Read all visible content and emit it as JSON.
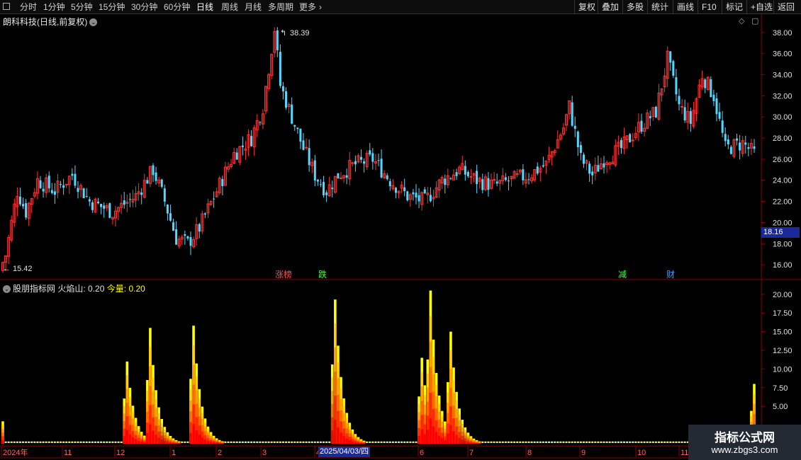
{
  "toolbar": {
    "periods": [
      "分时",
      "1分钟",
      "5分钟",
      "15分钟",
      "30分钟",
      "60分钟",
      "日线",
      "周线",
      "月线",
      "多周期",
      "更多"
    ],
    "active_period": "日线",
    "right_buttons": [
      "复权",
      "叠加",
      "多股",
      "统计",
      "画线",
      "F10",
      "标记",
      "+自选",
      "返回"
    ]
  },
  "main_chart": {
    "title": "朗科科技(日线,前复权)",
    "high_label": "38.39",
    "low_label": "15.42",
    "current_price": "18.16",
    "y_axis_labels": [
      "38.00",
      "36.00",
      "34.00",
      "32.00",
      "30.00",
      "28.00",
      "26.00",
      "24.00",
      "22.00",
      "20.00",
      "18.00",
      "16.00"
    ],
    "y_range": [
      14.8,
      39.6
    ],
    "event_markers": [
      {
        "text": "涨榜",
        "color": "#ff5050"
      },
      {
        "text": "跌",
        "color": "#40ff40"
      },
      {
        "text": "减",
        "color": "#40ff40"
      },
      {
        "text": "财",
        "color": "#40a0ff"
      }
    ]
  },
  "indicator": {
    "name": "股朋指标网",
    "line1_label": "火焰山:",
    "line1_value": "0.20",
    "line2_label": "今量:",
    "line2_value": "0.20",
    "y_axis_labels": [
      "20.00",
      "17.50",
      "15.00",
      "12.50",
      "10.00",
      "7.50",
      "5.00"
    ],
    "y_range": [
      0,
      21.5
    ]
  },
  "x_axis": {
    "labels": [
      "2024年",
      "11",
      "12",
      "1",
      "2",
      "3",
      "4",
      "5",
      "6",
      "7",
      "8",
      "9",
      "10",
      "11"
    ],
    "cursor_date": "2025/04/03/四"
  },
  "watermark": {
    "title": "指标公式网",
    "url": "www.zbgs3.com"
  },
  "colors": {
    "up": "#ff3232",
    "down": "#54d8ff",
    "axis": "#8b0000",
    "flame_outer": "#ff0000",
    "flame_inner": "#ffff00"
  },
  "chart_data": {
    "type": "candlestick",
    "title": "朗科科技(日线,前复权)",
    "x_range": [
      "2024年",
      "11"
    ],
    "ylim": [
      14.8,
      39.6
    ],
    "high": 38.39,
    "low": 15.42,
    "last_price": 18.16,
    "trend_points": [
      {
        "t": 0,
        "price": 15.42
      },
      {
        "t": 5,
        "price": 23.0
      },
      {
        "t": 8,
        "price": 21.0
      },
      {
        "t": 12,
        "price": 24.0
      },
      {
        "t": 18,
        "price": 23.0
      },
      {
        "t": 24,
        "price": 24.5
      },
      {
        "t": 30,
        "price": 22.0
      },
      {
        "t": 38,
        "price": 21.0
      },
      {
        "t": 46,
        "price": 22.5
      },
      {
        "t": 52,
        "price": 25.0
      },
      {
        "t": 56,
        "price": 22.0
      },
      {
        "t": 60,
        "price": 18.5
      },
      {
        "t": 64,
        "price": 18.0
      },
      {
        "t": 68,
        "price": 19.5
      },
      {
        "t": 74,
        "price": 23.0
      },
      {
        "t": 80,
        "price": 26.5
      },
      {
        "t": 86,
        "price": 28.0
      },
      {
        "t": 90,
        "price": 31.0
      },
      {
        "t": 94,
        "price": 38.39
      },
      {
        "t": 96,
        "price": 33.0
      },
      {
        "t": 100,
        "price": 30.0
      },
      {
        "t": 104,
        "price": 27.0
      },
      {
        "t": 108,
        "price": 24.5
      },
      {
        "t": 112,
        "price": 23.0
      },
      {
        "t": 116,
        "price": 24.5
      },
      {
        "t": 122,
        "price": 25.5
      },
      {
        "t": 128,
        "price": 26.0
      },
      {
        "t": 134,
        "price": 24.0
      },
      {
        "t": 140,
        "price": 22.5
      },
      {
        "t": 146,
        "price": 22.0
      },
      {
        "t": 152,
        "price": 24.0
      },
      {
        "t": 158,
        "price": 25.0
      },
      {
        "t": 164,
        "price": 24.0
      },
      {
        "t": 170,
        "price": 23.5
      },
      {
        "t": 176,
        "price": 24.0
      },
      {
        "t": 182,
        "price": 24.5
      },
      {
        "t": 188,
        "price": 25.5
      },
      {
        "t": 194,
        "price": 29.0
      },
      {
        "t": 196,
        "price": 31.0
      },
      {
        "t": 200,
        "price": 26.0
      },
      {
        "t": 204,
        "price": 24.5
      },
      {
        "t": 208,
        "price": 26.0
      },
      {
        "t": 214,
        "price": 27.0
      },
      {
        "t": 220,
        "price": 29.0
      },
      {
        "t": 226,
        "price": 30.5
      },
      {
        "t": 230,
        "price": 35.5
      },
      {
        "t": 234,
        "price": 31.0
      },
      {
        "t": 238,
        "price": 29.5
      },
      {
        "t": 242,
        "price": 34.0
      },
      {
        "t": 246,
        "price": 32.0
      },
      {
        "t": 250,
        "price": 27.0
      },
      {
        "t": 256,
        "price": 27.5
      },
      {
        "t": 260,
        "price": 26.5
      }
    ],
    "flame_peaks": [
      {
        "t": 43,
        "value": 11.0
      },
      {
        "t": 51,
        "value": 15.5
      },
      {
        "t": 66,
        "value": 15.8
      },
      {
        "t": 115,
        "value": 19.3
      },
      {
        "t": 145,
        "value": 11.5
      },
      {
        "t": 148,
        "value": 20.5
      },
      {
        "t": 155,
        "value": 15.0
      },
      {
        "t": 260,
        "value": 8.0
      }
    ]
  }
}
